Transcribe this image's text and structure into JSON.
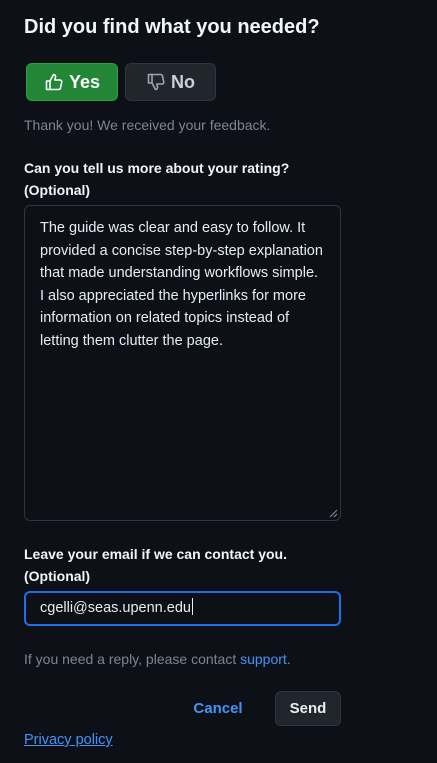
{
  "feedback": {
    "title": "Did you find what you needed?",
    "yes_label": "Yes",
    "no_label": "No",
    "yes_icon": "thumbs-up-icon",
    "no_icon": "thumbs-down-icon",
    "selected": "Yes",
    "thanks_message": "Thank you! We received your feedback."
  },
  "rating_comment": {
    "label_line1": "Can you tell us more about your rating?",
    "label_line2": "(Optional)",
    "value": "The guide was clear and easy to follow. It provided a concise step-by-step explanation that made understanding workflows simple. I also appreciated the hyperlinks for more information on related topics instead of letting them clutter the page."
  },
  "email": {
    "label_line1": "Leave your email if we can contact you.",
    "label_line2": "(Optional)",
    "value": "cgelli@seas.upenn.edu"
  },
  "reply_note": {
    "text": "If you need a reply, please contact ",
    "link_text": "support",
    "suffix": "."
  },
  "actions": {
    "cancel_label": "Cancel",
    "send_label": "Send"
  },
  "footer": {
    "privacy_label": "Privacy policy"
  },
  "colors": {
    "background": "#0d1117",
    "yes_active": "#238636",
    "link": "#4493f8",
    "focus_border": "#1f6feb"
  }
}
